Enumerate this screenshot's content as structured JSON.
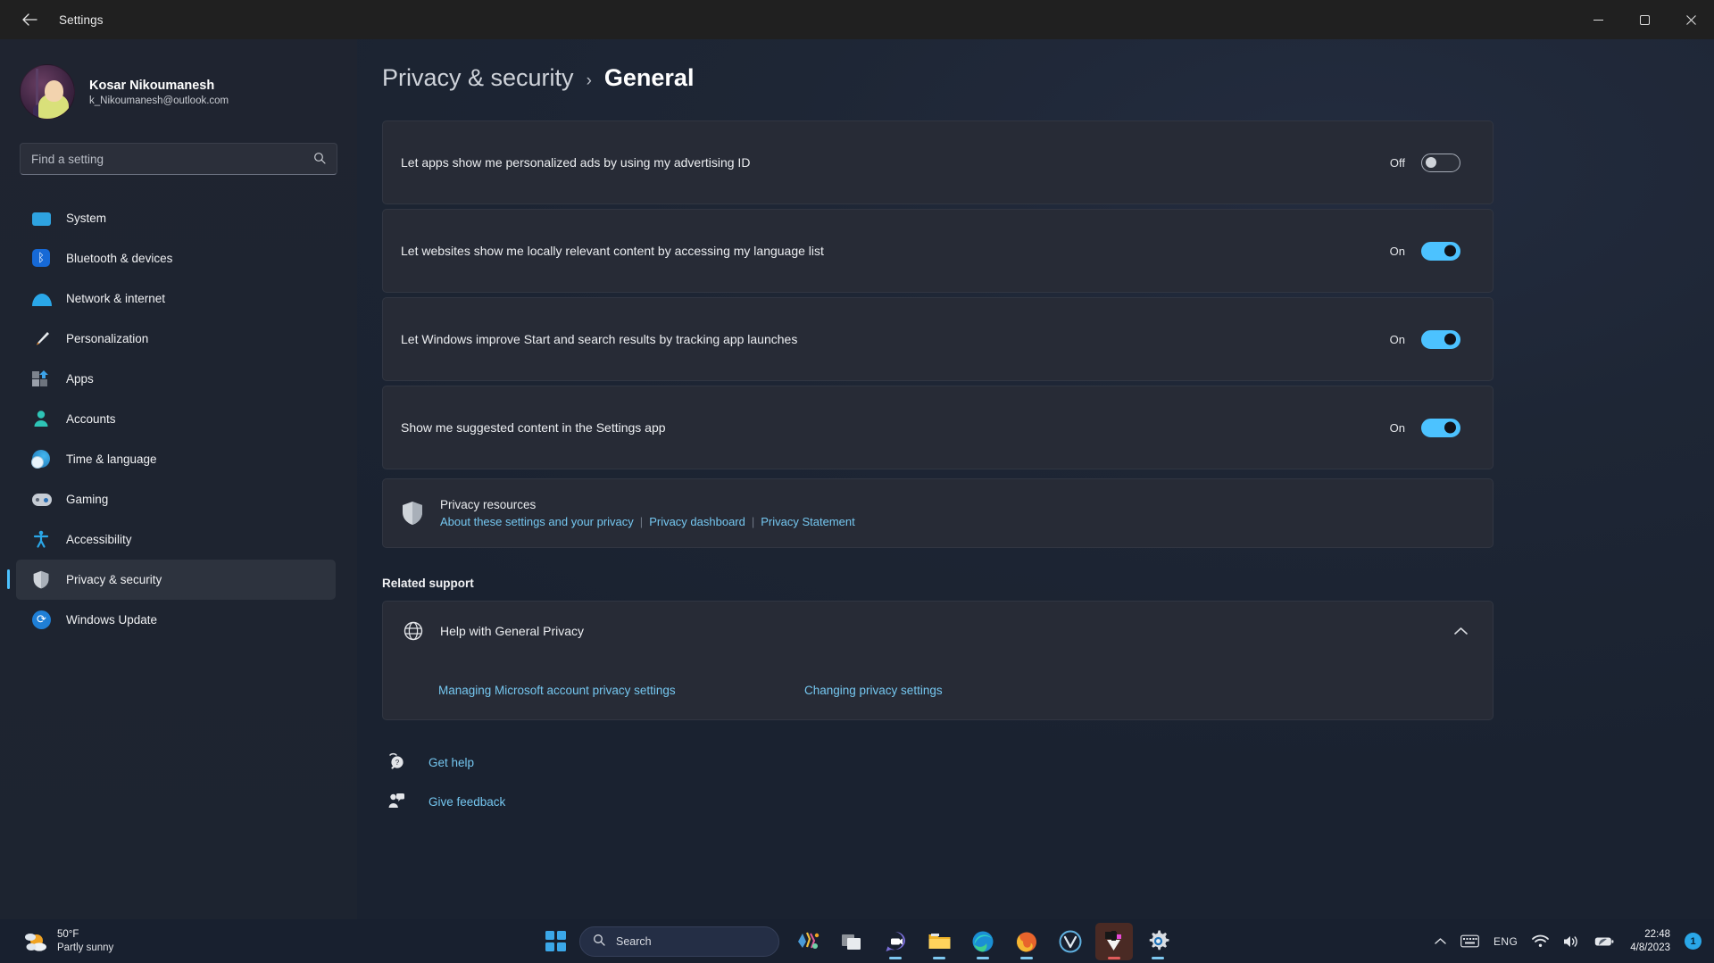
{
  "titlebar": {
    "title": "Settings",
    "back_icon": "arrow-left-icon",
    "minimize": "–",
    "maximize": "□",
    "close": "✕"
  },
  "sidebar": {
    "account": {
      "name": "Kosar Nikoumanesh",
      "email": "k_Nikoumanesh@outlook.com"
    },
    "search": {
      "placeholder": "Find a setting",
      "value": "",
      "icon": "search-icon"
    },
    "items": [
      {
        "label": "System",
        "icon": "monitor-icon",
        "active": false
      },
      {
        "label": "Bluetooth & devices",
        "icon": "bluetooth-icon",
        "active": false
      },
      {
        "label": "Network & internet",
        "icon": "wifi-icon",
        "active": false
      },
      {
        "label": "Personalization",
        "icon": "paintbrush-icon",
        "active": false
      },
      {
        "label": "Apps",
        "icon": "apps-grid-icon",
        "active": false
      },
      {
        "label": "Accounts",
        "icon": "person-icon",
        "active": false
      },
      {
        "label": "Time & language",
        "icon": "clock-globe-icon",
        "active": false
      },
      {
        "label": "Gaming",
        "icon": "gamepad-icon",
        "active": false
      },
      {
        "label": "Accessibility",
        "icon": "accessibility-icon",
        "active": false
      },
      {
        "label": "Privacy & security",
        "icon": "shield-icon",
        "active": true
      },
      {
        "label": "Windows Update",
        "icon": "refresh-icon",
        "active": false
      }
    ]
  },
  "breadcrumb": {
    "parent": "Privacy & security",
    "separator": "›",
    "current": "General"
  },
  "settings": [
    {
      "label": "Let apps show me personalized ads by using my advertising ID",
      "state": "Off",
      "on": false
    },
    {
      "label": "Let websites show me locally relevant content by accessing my language list",
      "state": "On",
      "on": true
    },
    {
      "label": "Let Windows improve Start and search results by tracking app launches",
      "state": "On",
      "on": true
    },
    {
      "label": "Show me suggested content in the Settings app",
      "state": "On",
      "on": true
    }
  ],
  "privacy_resources": {
    "icon": "shield-icon",
    "title": "Privacy resources",
    "links": [
      "About these settings and your privacy",
      "Privacy dashboard",
      "Privacy Statement"
    ],
    "divider": "|"
  },
  "related_support": {
    "title": "Related support",
    "help_icon": "globe-help-icon",
    "help_title": "Help with General Privacy",
    "chevron": "chevron-up-icon",
    "links": [
      "Managing Microsoft account privacy settings",
      "Changing privacy settings"
    ]
  },
  "footer": {
    "get_help": {
      "label": "Get help",
      "icon": "help-question-icon"
    },
    "give_feedback": {
      "label": "Give feedback",
      "icon": "feedback-icon"
    }
  },
  "taskbar": {
    "weather": {
      "temperature": "50°F",
      "condition": "Partly sunny",
      "icon": "partly-sunny-icon"
    },
    "start": {
      "icon": "windows-start-icon"
    },
    "search": {
      "placeholder": "Search",
      "icon": "search-icon"
    },
    "apps": [
      {
        "name": "widgets-icon",
        "running": false,
        "active": false
      },
      {
        "name": "task-view-icon",
        "running": false,
        "active": false
      },
      {
        "name": "teams-chat-icon",
        "running": true,
        "active": false
      },
      {
        "name": "file-explorer-icon",
        "running": true,
        "active": false
      },
      {
        "name": "microsoft-edge-icon",
        "running": true,
        "active": false
      },
      {
        "name": "firefox-icon",
        "running": true,
        "active": false
      },
      {
        "name": "vivaldi-icon",
        "running": false,
        "active": false
      },
      {
        "name": "idm-download-icon",
        "running": true,
        "active": true
      },
      {
        "name": "settings-gear-icon",
        "running": true,
        "active": false
      }
    ],
    "tray": {
      "chevron": "chevron-up-icon",
      "keyboard": "keyboard-icon",
      "language": "ENG",
      "wifi": "wifi-icon",
      "volume": "speaker-icon",
      "battery": "battery-icon",
      "time": "22:48",
      "date": "4/8/2023",
      "notification_count": "1"
    }
  },
  "colors": {
    "accent": "#4cc2ff",
    "link": "#75c7f0",
    "sidebar_bg": "#1f2430",
    "card_bg": "#272b36",
    "taskbar_bg": "#18202f"
  }
}
